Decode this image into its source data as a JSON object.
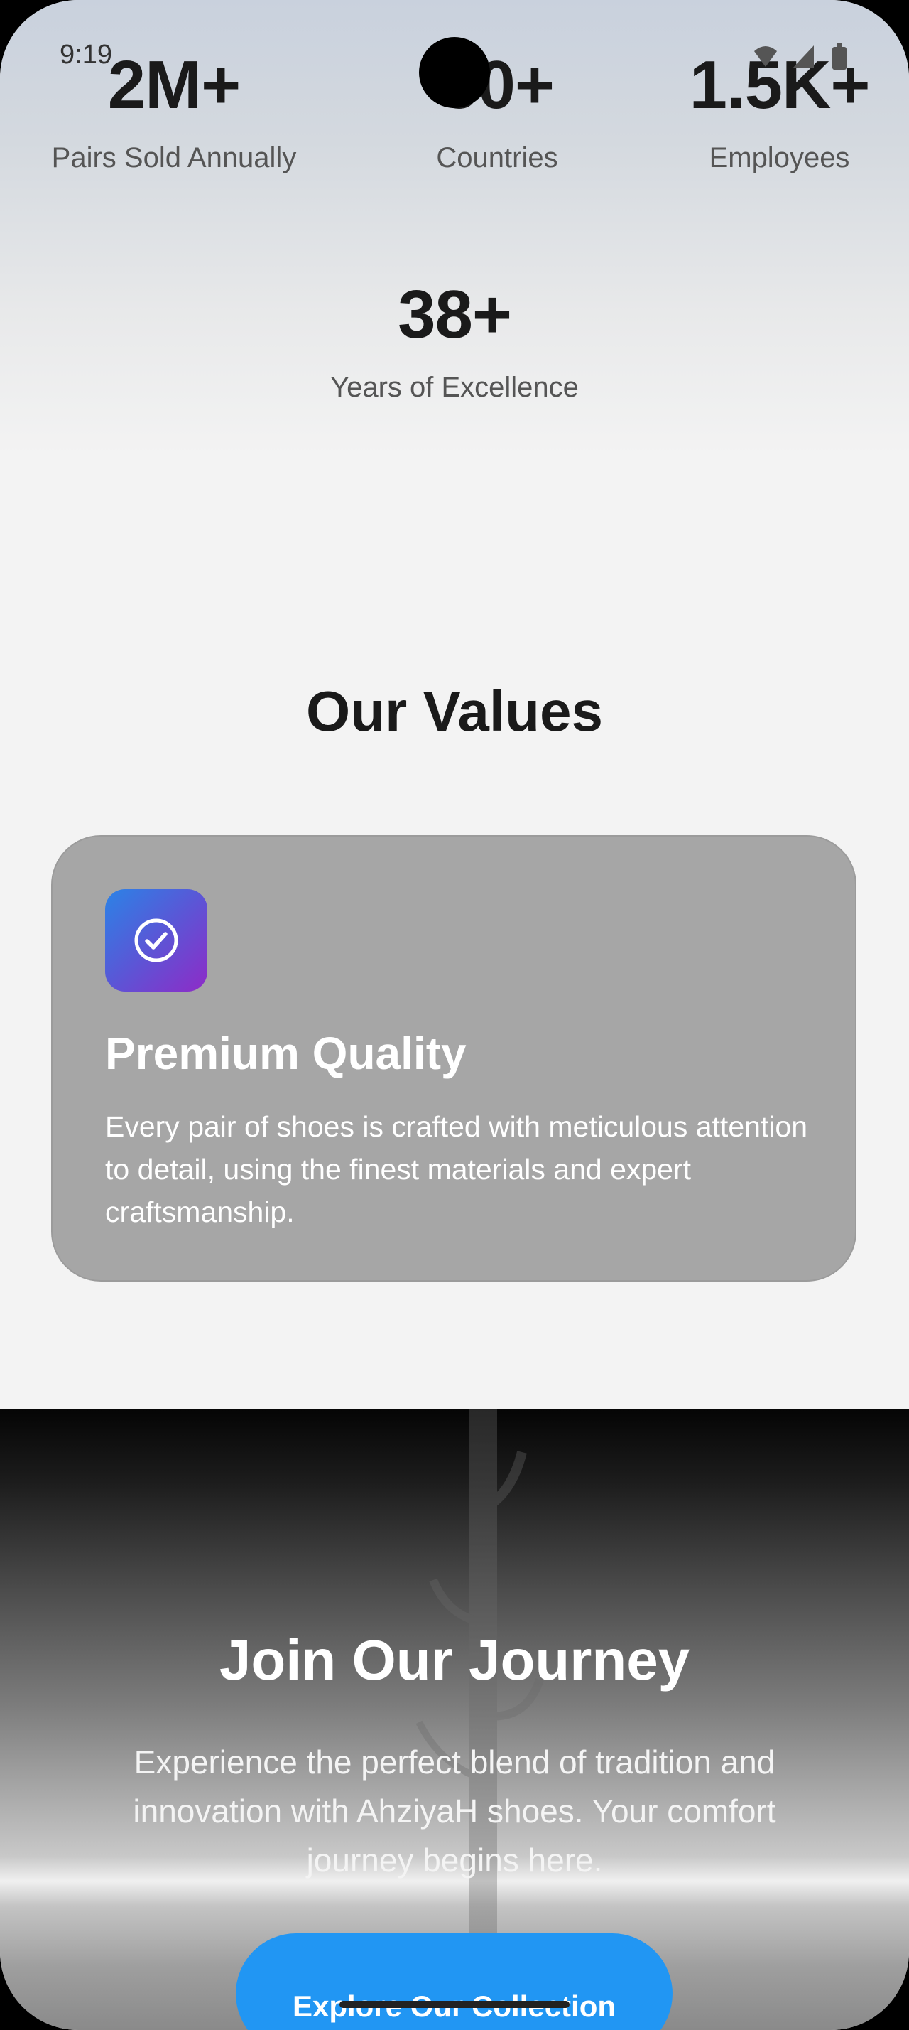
{
  "status_bar": {
    "time": "9:19",
    "icons": [
      "wifi-icon",
      "signal-icon",
      "battery-icon"
    ]
  },
  "stats": [
    {
      "number": "2M+",
      "label": "Pairs Sold Annually"
    },
    {
      "number": "50+",
      "label": "Countries"
    },
    {
      "number": "1.5K+",
      "label": "Employees"
    },
    {
      "number": "38+",
      "label": "Years of Excellence"
    }
  ],
  "values_section": {
    "title": "Our Values",
    "cards": [
      {
        "icon": "check-circle-icon",
        "title": "Premium Quality",
        "description": "Every pair of shoes is crafted with meticulous attention to detail, using the finest materials and expert craftsmanship."
      }
    ]
  },
  "journey": {
    "title": "Join Our Journey",
    "description": "Experience the perfect blend of tradition and innovation with AhziyaH shoes. Your comfort journey begins here.",
    "cta_label": "Explore Our Collection"
  },
  "colors": {
    "accent": "#2196f3",
    "card_bg": "#a6a6a6",
    "icon_gradient_start": "#2b83e6",
    "icon_gradient_end": "#8e2bc7"
  }
}
